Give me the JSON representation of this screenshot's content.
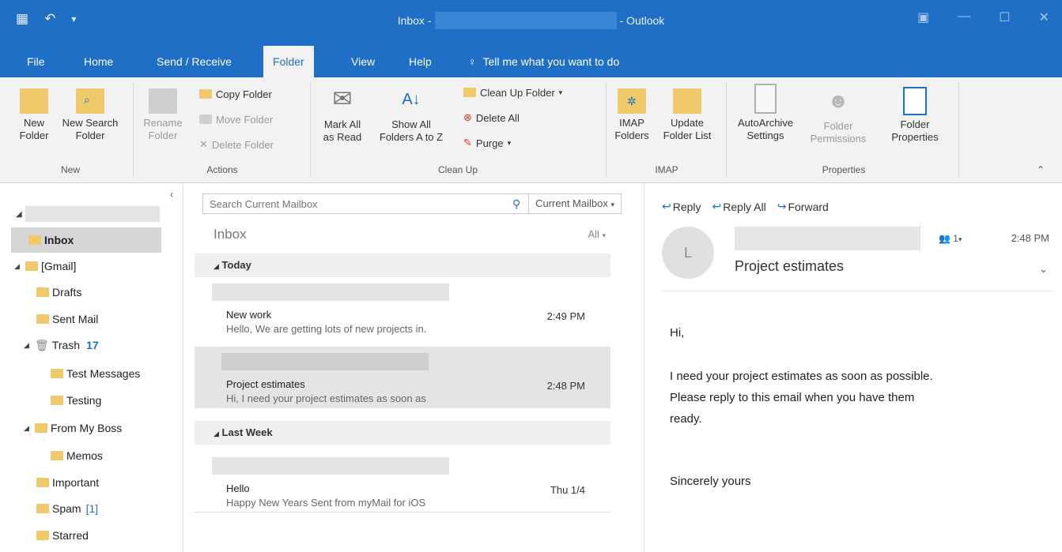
{
  "titlebar": {
    "title_prefix": "Inbox -",
    "title_suffix": "- Outlook",
    "icons": [
      "outlook-app-icon",
      "undo-icon",
      "quick-access-dropdown-icon",
      "ribbon-display-icon",
      "minimize-icon",
      "maximize-icon",
      "close-icon"
    ]
  },
  "tabs": {
    "file": "File",
    "home": "Home",
    "send_receive": "Send / Receive",
    "folder": "Folder",
    "view": "View",
    "help": "Help",
    "tell_me": "Tell me what you want to do"
  },
  "ribbon": {
    "new_folder": [
      "New",
      "Folder"
    ],
    "new_search_folder": [
      "New Search",
      "Folder"
    ],
    "rename_folder": [
      "Rename",
      "Folder"
    ],
    "copy_folder": "Copy Folder",
    "move_folder": "Move Folder",
    "delete_folder": "Delete Folder",
    "mark_all_read": [
      "Mark All",
      "as Read"
    ],
    "show_all_folders": [
      "Show All",
      "Folders A to Z"
    ],
    "clean_up_folder": "Clean Up Folder",
    "delete_all": "Delete All",
    "purge": "Purge",
    "imap_folders": [
      "IMAP",
      "Folders"
    ],
    "update_folder_list": [
      "Update",
      "Folder List"
    ],
    "autoarchive": [
      "AutoArchive",
      "Settings"
    ],
    "folder_permissions": [
      "Folder",
      "Permissions"
    ],
    "folder_properties": [
      "Folder",
      "Properties"
    ],
    "groups": {
      "new": "New",
      "actions": "Actions",
      "clean_up": "Clean Up",
      "imap": "IMAP",
      "properties": "Properties"
    }
  },
  "folders": {
    "inbox": "Inbox",
    "gmail": "[Gmail]",
    "drafts": "Drafts",
    "sent_mail": "Sent Mail",
    "trash": "Trash",
    "trash_count": "17",
    "test_messages": "Test Messages",
    "testing": "Testing",
    "from_my_boss": "From My Boss",
    "memos": "Memos",
    "important": "Important",
    "spam": "Spam",
    "spam_count": "[1]",
    "starred": "Starred"
  },
  "list": {
    "search_placeholder": "Search Current Mailbox",
    "search_scope": "Current Mailbox",
    "title": "Inbox",
    "filter": "All",
    "groups": [
      "Today",
      "Last Week"
    ],
    "messages": [
      {
        "subject": "New work",
        "preview": "Hello,  We are getting lots of new projects in.",
        "time": "2:49 PM"
      },
      {
        "subject": "Project estimates",
        "preview": "Hi,  I need your project estimates as soon as",
        "time": "2:48 PM"
      },
      {
        "subject": "Hello",
        "preview": "Happy New Years  Sent from myMail for iOS",
        "time": "Thu 1/4"
      }
    ]
  },
  "reading": {
    "reply": "Reply",
    "reply_all": "Reply All",
    "forward": "Forward",
    "avatar_initial": "L",
    "people_count": "1",
    "time": "2:48 PM",
    "subject": "Project estimates",
    "body": [
      "Hi,",
      "I need your project estimates as soon as possible.",
      "Please reply to this email when you have them",
      "ready.",
      "Sincerely yours"
    ]
  },
  "colors": {
    "accent": "#1e6fc5",
    "ribbon_bg": "#f2f2f2",
    "folder_yellow": "#f0c96a",
    "selection_gray": "#d6d6d6"
  }
}
